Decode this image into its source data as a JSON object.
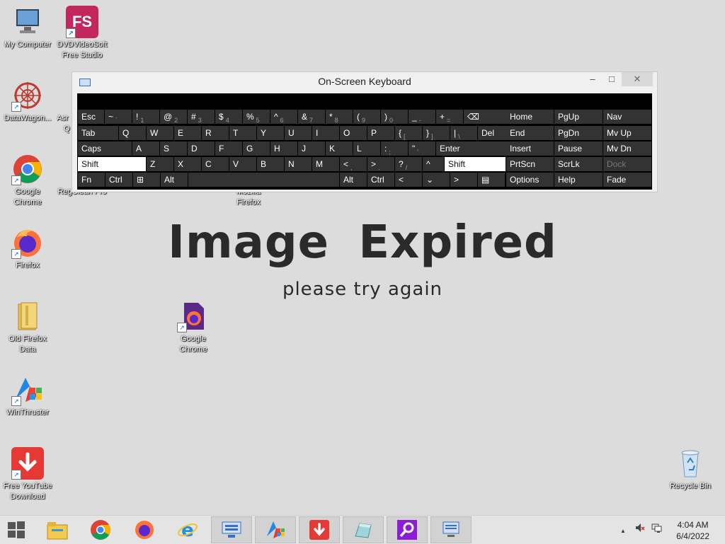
{
  "desktop": {
    "icons": [
      {
        "label_1": "My Computer",
        "label_2": "",
        "icon": "computer-icon"
      },
      {
        "label_1": "DVDVideoSoft",
        "label_2": "Free Studio",
        "icon": "fs-icon",
        "badge": "FS"
      },
      {
        "label_1": "DataWagon...",
        "label_2": "",
        "icon": "datawagon-icon"
      },
      {
        "label_1": "Asr",
        "label_2": "Q",
        "icon": "app-icon"
      },
      {
        "label_1": "Google",
        "label_2": "Chrome",
        "icon": "chrome-icon"
      },
      {
        "label_1": "RegClean Pro",
        "label_2": "",
        "icon": "regclean-icon"
      },
      {
        "label_1": "Mozilla",
        "label_2": "Firefox",
        "icon": "firefox-icon"
      },
      {
        "label_1": "Firefox",
        "label_2": "",
        "icon": "firefox-icon"
      },
      {
        "label_1": "Old Firefox",
        "label_2": "Data",
        "icon": "folder-icon"
      },
      {
        "label_1": "Google",
        "label_2": "Chrome",
        "icon": "firefox-file-icon"
      },
      {
        "label_1": "WinThruster",
        "label_2": "",
        "icon": "winthruster-icon"
      },
      {
        "label_1": "Free YouTube",
        "label_2": "Download",
        "icon": "download-icon"
      },
      {
        "label_1": "Recycle Bin",
        "label_2": "",
        "icon": "recycle-bin-icon"
      }
    ]
  },
  "watermark": {
    "title": "Image Expired",
    "subtitle": "please try again"
  },
  "osk": {
    "title": "On-Screen Keyboard",
    "minimize": "–",
    "maximize": "□",
    "close": "✕",
    "row1": [
      {
        "p": "Esc",
        "s": ""
      },
      {
        "p": "~",
        "s": "`"
      },
      {
        "p": "!",
        "s": "1"
      },
      {
        "p": "@",
        "s": "2"
      },
      {
        "p": "#",
        "s": "3"
      },
      {
        "p": "$",
        "s": "4"
      },
      {
        "p": "%",
        "s": "5"
      },
      {
        "p": "^",
        "s": "6"
      },
      {
        "p": "&",
        "s": "7"
      },
      {
        "p": "*",
        "s": "8"
      },
      {
        "p": "(",
        "s": "9"
      },
      {
        "p": ")",
        "s": "0"
      },
      {
        "p": "_",
        "s": "-"
      },
      {
        "p": "+",
        "s": "="
      },
      {
        "p": "⌫",
        "s": ""
      }
    ],
    "row2": [
      "Tab",
      "Q",
      "W",
      "E",
      "R",
      "T",
      "Y",
      "U",
      "I",
      "O",
      "P",
      "{",
      "}",
      "|",
      "Del"
    ],
    "row2_sub": [
      "",
      "",
      "",
      "",
      "",
      "",
      "",
      "",
      "",
      "",
      "",
      "[",
      "]",
      "\\",
      ""
    ],
    "row3": [
      "Caps",
      "A",
      "S",
      "D",
      "F",
      "G",
      "H",
      "J",
      "K",
      "L",
      ":",
      "\"",
      "Enter"
    ],
    "row3_sub": [
      "",
      "",
      "",
      "",
      "",
      "",
      "",
      "",
      "",
      "",
      ";",
      "'",
      ""
    ],
    "row4": [
      "Shift",
      "Z",
      "X",
      "C",
      "V",
      "B",
      "N",
      "M",
      "<",
      ">",
      "?",
      "^",
      "Shift"
    ],
    "row4_sub": [
      "",
      "",
      "",
      "",
      "",
      "",
      "",
      "",
      ",",
      ".",
      "/",
      "",
      ""
    ],
    "row5": [
      "Fn",
      "Ctrl",
      "⊞",
      "Alt",
      "",
      "Alt",
      "Ctrl",
      "<",
      "⌄",
      ">",
      "▤"
    ],
    "nav": [
      [
        "Home",
        "PgUp",
        "Nav"
      ],
      [
        "End",
        "PgDn",
        "Mv Up"
      ],
      [
        "Insert",
        "Pause",
        "Mv Dn"
      ],
      [
        "PrtScn",
        "ScrLk",
        "Dock"
      ],
      [
        "Options",
        "Help",
        "Fade"
      ]
    ]
  },
  "taskbar": {
    "start": "start-icon",
    "pinned": [
      "file-explorer-icon",
      "chrome-icon",
      "firefox-icon",
      "internet-explorer-icon",
      "osk-icon",
      "winthruster-icon",
      "download-icon",
      "app-icon",
      "search-app-icon",
      "monitor-icon"
    ],
    "tray_chevron": "▲",
    "time": "4:04 AM",
    "date": "6/4/2022"
  },
  "colors": {
    "desktop": "#dcdcdc",
    "key": "#333333",
    "key_active": "#ffffff",
    "taskbar": "#e4e4e4"
  }
}
